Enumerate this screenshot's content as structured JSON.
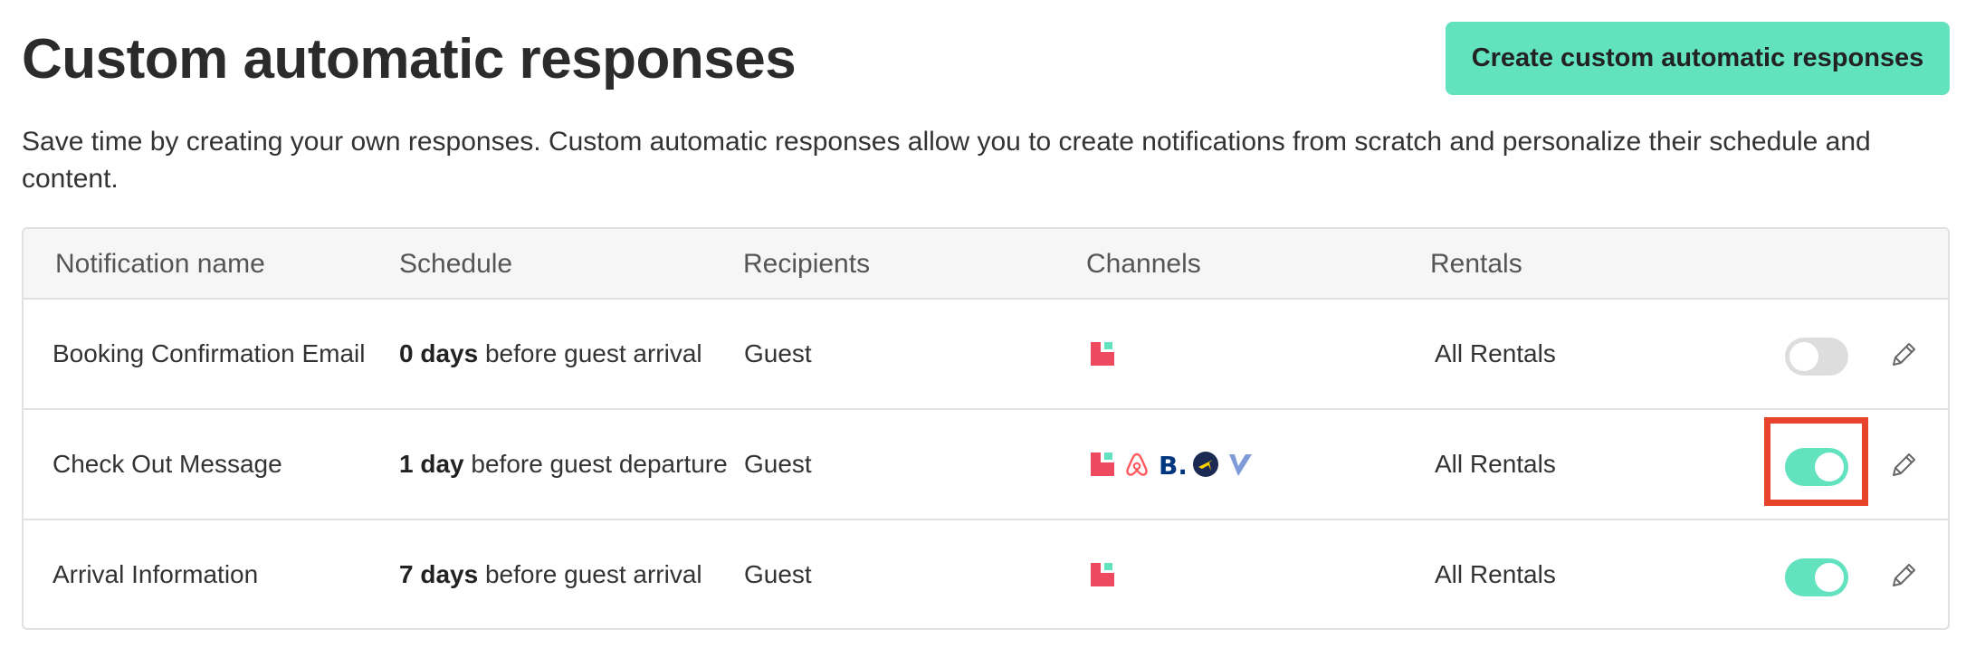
{
  "page": {
    "title": "Custom automatic responses",
    "create_button_label": "Create custom automatic responses",
    "description": "Save time by creating your own responses. Custom automatic responses allow you to create notifications from scratch and personalize their schedule and content."
  },
  "table": {
    "headers": {
      "name": "Notification name",
      "schedule": "Schedule",
      "recipients": "Recipients",
      "channels": "Channels",
      "rentals": "Rentals"
    },
    "rows": [
      {
        "name": "Booking Confirmation Email",
        "schedule_bold": "0 days",
        "schedule_rest": " before guest arrival",
        "recipients": "Guest",
        "channels": [
          "lodgify-icon"
        ],
        "rentals": "All Rentals",
        "enabled": false
      },
      {
        "name": "Check Out Message",
        "schedule_bold": "1 day",
        "schedule_rest": " before guest departure",
        "recipients": "Guest",
        "channels": [
          "lodgify-icon",
          "airbnb-icon",
          "booking-com-icon",
          "expedia-icon",
          "vrbo-icon"
        ],
        "rentals": "All Rentals",
        "enabled": true
      },
      {
        "name": "Arrival Information",
        "schedule_bold": "7 days",
        "schedule_rest": " before guest arrival",
        "recipients": "Guest",
        "channels": [
          "lodgify-icon"
        ],
        "rentals": "All Rentals",
        "enabled": true
      }
    ]
  },
  "colors": {
    "accent": "#63e2bf",
    "toggle_off": "#dddddd",
    "highlight": "#e8432b",
    "lodgify": "#ee4a5f",
    "airbnb": "#ff5a5f",
    "booking": "#003580",
    "expedia": "#1b2a52",
    "vrbo": "#7e9bd7"
  }
}
